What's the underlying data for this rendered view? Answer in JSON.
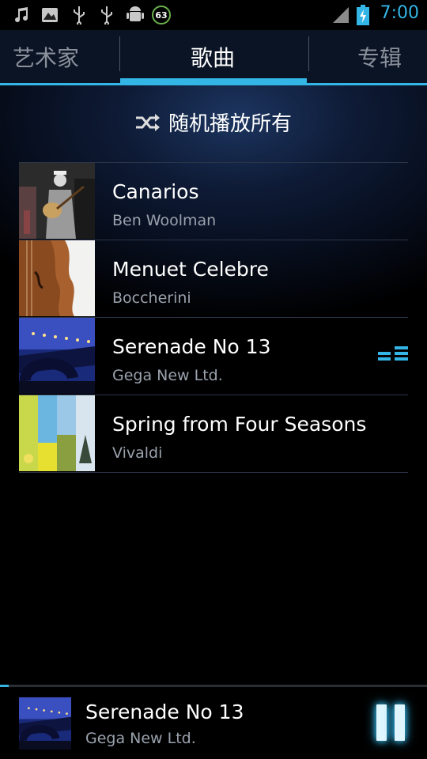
{
  "status_bar": {
    "time": "7:00",
    "battery_badge": "63",
    "icons": [
      "music-note-icon",
      "gallery-icon",
      "usb-icon",
      "usb-icon",
      "android-debug-icon",
      "battery-level-badge",
      "signal-icon",
      "battery-charging-icon"
    ]
  },
  "tabs": [
    {
      "label": "艺术家",
      "selected": false
    },
    {
      "label": "歌曲",
      "selected": true
    },
    {
      "label": "专辑",
      "selected": false
    }
  ],
  "shuffle": {
    "label": "随机播放所有",
    "icon": "shuffle-icon"
  },
  "songs": [
    {
      "title": "Canarios",
      "artist": "Ben Woolman",
      "playing": false
    },
    {
      "title": "Menuet Celebre",
      "artist": "Boccherini",
      "playing": false
    },
    {
      "title": "Serenade No 13",
      "artist": "Gega New Ltd.",
      "playing": true
    },
    {
      "title": "Spring from Four Seasons",
      "artist": "Vivaldi",
      "playing": false
    }
  ],
  "now_playing": {
    "title": "Serenade No 13",
    "artist": "Gega New Ltd.",
    "progress": 0.02,
    "control": "pause-icon"
  },
  "colors": {
    "accent": "#33b5e5",
    "background": "#000000",
    "secondary_text": "#9aa2ad"
  }
}
